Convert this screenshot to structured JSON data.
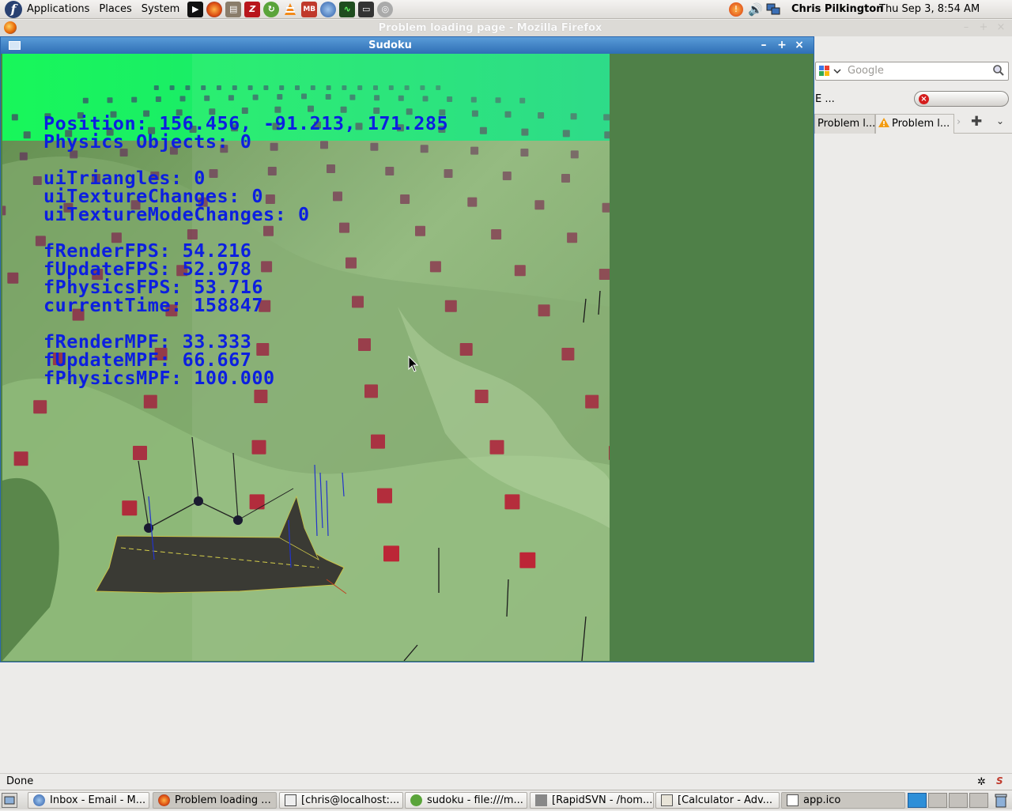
{
  "top_panel": {
    "menus": [
      "Applications",
      "Places",
      "System"
    ],
    "launchers": [
      "terminal-launcher",
      "firefox-launcher",
      "document-viewer-launcher",
      "filezilla-launcher",
      "rapidsvn-launcher",
      "vlc-launcher",
      "mysql-workbench-launcher",
      "thunderbird-launcher",
      "system-monitor-launcher",
      "shell-launcher",
      "help-launcher"
    ],
    "user": "Chris Pilkington",
    "clock": "Thu Sep  3,  8:54 AM"
  },
  "firefox": {
    "title": "Problem loading page - Mozilla Firefox",
    "search_placeholder": "Google",
    "url_fragment": "E ...",
    "tabs": [
      "Problem l...",
      "Problem l..."
    ],
    "status": "Done"
  },
  "sudoku_window": {
    "title": "Sudoku",
    "hud": {
      "position": "Position: 156.456, -91.213, 171.285",
      "physics_objects": "Physics Objects: 0",
      "ui_triangles": "uiTriangles: 0",
      "ui_texture_changes": "uiTextureChanges: 0",
      "ui_texture_mode_changes": "uiTextureModeChanges: 0",
      "render_fps": "fRenderFPS: 54.216",
      "update_fps": "fUpdateFPS: 52.978",
      "physics_fps": "fPhysicsFPS: 53.716",
      "current_time": "currentTime: 158847",
      "render_mpf": "fRenderMPF: 33.333",
      "update_mpf": "fUpdateMPF: 66.667",
      "physics_mpf": "fPhysicsMPF: 100.000"
    }
  },
  "taskbar": {
    "items": [
      "Inbox - Email - M...",
      "Problem loading ...",
      "[chris@localhost:...",
      "sudoku - file:///m...",
      "[RapidSVN - /hom...",
      "[Calculator - Adv...",
      "app.ico"
    ]
  },
  "colors": {
    "hud_text": "#0c1fe0",
    "titlebar_active": "#3a7cc1",
    "window_background": "#4f8048"
  }
}
